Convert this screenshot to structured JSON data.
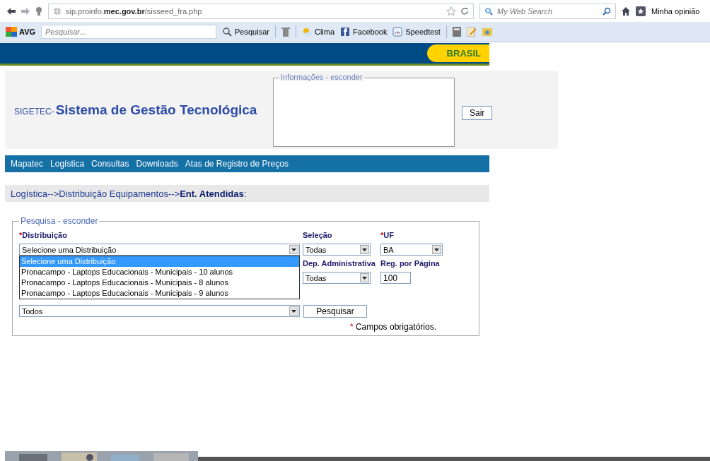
{
  "browser": {
    "url": "sip.proinfo.**mec.gov.br**/sisseed_fra.php",
    "search_placeholder": "My Web Search",
    "feedback": "Minha opinião"
  },
  "toolbar": {
    "brand": "AVG",
    "search_placeholder": "Pesquisar...",
    "buttons": [
      {
        "kind": "search",
        "label": "Pesquisar"
      },
      {
        "kind": "weather",
        "label": "Clima"
      },
      {
        "kind": "facebook",
        "label": "Facebook"
      },
      {
        "kind": "speed",
        "label": "Speedtest"
      }
    ]
  },
  "banner": {
    "badge": "BRASIL"
  },
  "header": {
    "prefix": "SIGETEC-",
    "title": "Sistema de Gestão Tecnológica",
    "info_legend": "Informações - esconder",
    "logout": "Sair"
  },
  "menu": {
    "items": [
      "Mapatec",
      "Logística",
      "Consultas",
      "Downloads",
      "Atas de Registro de Preços"
    ]
  },
  "breadcrumb": "Logística-->Distribuição Equipamentos-->**Ent. Atendidas**:",
  "search": {
    "legend": "Pesquisa - esconder",
    "distribution": {
      "mark": "*",
      "label": "Distribuição",
      "value": "Selecione uma Distribuição",
      "options": [
        {
          "label": "Selecione uma Distribuição",
          "selected": true
        },
        {
          "label": "Pronacampo - Laptops Educacionais - Municipais - 10 alunos",
          "selected": false
        },
        {
          "label": "Pronacampo - Laptops Educacionais - Municipais - 8 alunos",
          "selected": false
        },
        {
          "label": "Pronacampo - Laptops Educacionais - Municipais - 9 alunos",
          "selected": false
        }
      ]
    },
    "selection": {
      "label": "Seleção",
      "value": "Todas"
    },
    "uf": {
      "mark": "*",
      "label": "UF",
      "value": "BA"
    },
    "dependency": {
      "label": "Dep. Administrativa",
      "value": "Todas"
    },
    "per_page": {
      "label": "Reg. por Página",
      "value": "100"
    },
    "filter": {
      "value": "Todos"
    },
    "submit": "Pesquisar",
    "note": {
      "mark": "*",
      "text": "Campos obrigatórios."
    }
  }
}
